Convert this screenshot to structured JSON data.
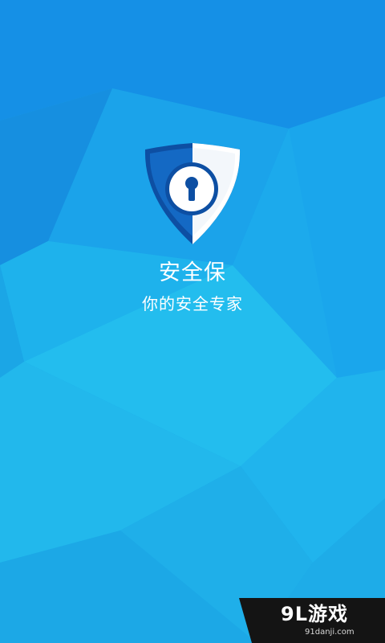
{
  "app": {
    "name": "安全保",
    "tagline": "你的安全专家"
  },
  "watermark": {
    "logo": "9L游戏",
    "url": "91danji.com"
  },
  "colors": {
    "background": "#1aa6e8",
    "shield_dark": "#0d4fa3",
    "shield_light": "#ffffff",
    "text": "#ffffff"
  },
  "icons": {
    "logo": "shield-keyhole-icon"
  }
}
